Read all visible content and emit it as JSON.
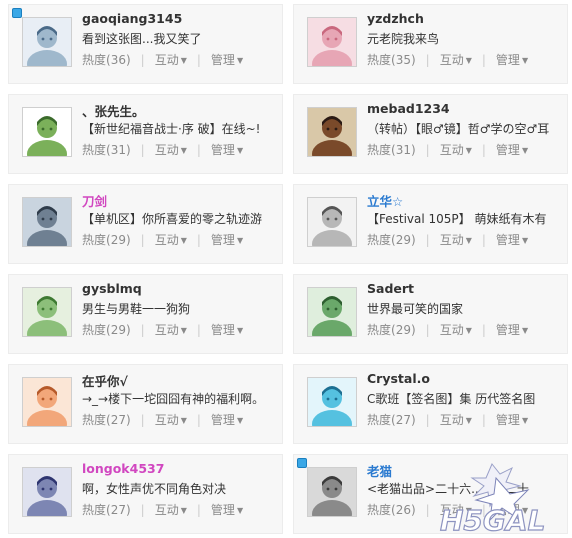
{
  "labels": {
    "hot": "热度",
    "interact": "互动",
    "manage": "管理"
  },
  "cards": [
    {
      "name": "gaoqiang3145",
      "name_color": "#333333",
      "status": "看到这张图...我又笑了",
      "hot": "(36)",
      "online": true,
      "avatar_colors": [
        "#e8eef5",
        "#9fb8cc",
        "#4a6a88"
      ]
    },
    {
      "name": "yzdzhch",
      "name_color": "#333333",
      "status": "元老院我来鸟",
      "hot": "(35)",
      "online": false,
      "avatar_colors": [
        "#f6dde3",
        "#e7a6b5",
        "#c9687e"
      ]
    },
    {
      "name": "、张先生。",
      "name_color": "#333333",
      "status": "【新世纪福音战士·序  破】在线~!",
      "hot": "(31)",
      "online": false,
      "avatar_colors": [
        "#ffffff",
        "#7bb05a",
        "#3b6b2c"
      ]
    },
    {
      "name": "mebad1234",
      "name_color": "#333333",
      "status": "（转帖）【眼♂镜】哲♂学の空♂耳",
      "hot": "(31)",
      "online": false,
      "avatar_colors": [
        "#d9c8a8",
        "#7a4a2a",
        "#2a1a14"
      ]
    },
    {
      "name": "刀剑",
      "name_color": "#d147c0",
      "status": "【单机区】你所喜爱的零之轨迹游",
      "hot": "(29)",
      "online": false,
      "avatar_colors": [
        "#c9d4df",
        "#6f8092",
        "#2f3c4b"
      ]
    },
    {
      "name": "立华☆",
      "name_color": "#2a7ad0",
      "status": "【Festival 105P】 萌妹纸有木有",
      "hot": "(29)",
      "online": false,
      "avatar_colors": [
        "#f2f2f2",
        "#b7b7b7",
        "#555555"
      ]
    },
    {
      "name": "gysblmq",
      "name_color": "#333333",
      "status": "男生与男鞋一一狗狗",
      "hot": "(29)",
      "online": false,
      "avatar_colors": [
        "#e6f0df",
        "#8cbf7a",
        "#3e7a32"
      ]
    },
    {
      "name": "Sadert",
      "name_color": "#333333",
      "status": "世界最可笑的国家",
      "hot": "(29)",
      "online": false,
      "avatar_colors": [
        "#dfeedd",
        "#6aa86a",
        "#2d5e2f"
      ]
    },
    {
      "name": "在乎你√",
      "name_color": "#333333",
      "status": "→_→楼下一坨囧囧有神的福利啊。",
      "hot": "(27)",
      "online": false,
      "avatar_colors": [
        "#fbe6d6",
        "#f2a77a",
        "#b65a2a"
      ]
    },
    {
      "name": "Crystal.o",
      "name_color": "#333333",
      "status": "C歌班【签名图】集 历代签名图",
      "hot": "(27)",
      "online": false,
      "avatar_colors": [
        "#e3f5fb",
        "#55c1e0",
        "#1c6f92"
      ]
    },
    {
      "name": "longok4537",
      "name_color": "#d147c0",
      "status": "啊，女性声优不同角色对决",
      "hot": "(27)",
      "online": false,
      "avatar_colors": [
        "#dfe2ef",
        "#7d86b3",
        "#2e3570"
      ]
    },
    {
      "name": "老猫",
      "name_color": "#2a7ad0",
      "status": "<老猫出品>二十六...M，二十",
      "hot": "(26)",
      "online": true,
      "avatar_colors": [
        "#d9d9d9",
        "#8a8a8a",
        "#3a3a3a"
      ]
    }
  ],
  "watermark": {
    "text": "H5GAL"
  }
}
